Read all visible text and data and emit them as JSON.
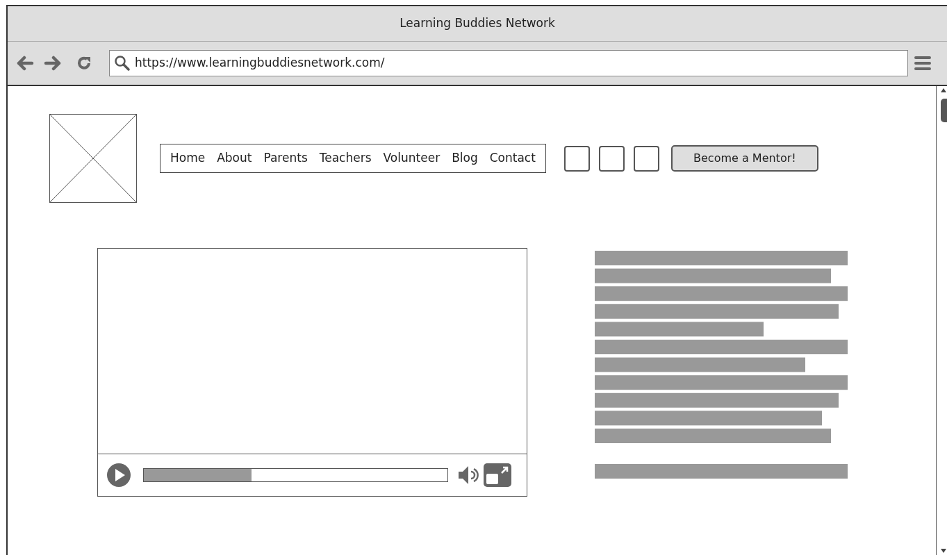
{
  "window": {
    "title": "Learning Buddies Network"
  },
  "address_bar": {
    "url": "https://www.learningbuddiesnetwork.com/"
  },
  "nav": {
    "items": [
      "Home",
      "About",
      "Parents",
      "Teachers",
      "Volunteer",
      "Blog",
      "Contact"
    ]
  },
  "cta_button": "Become a Mentor!",
  "video": {
    "progress": {
      "level": 0.355
    }
  }
}
